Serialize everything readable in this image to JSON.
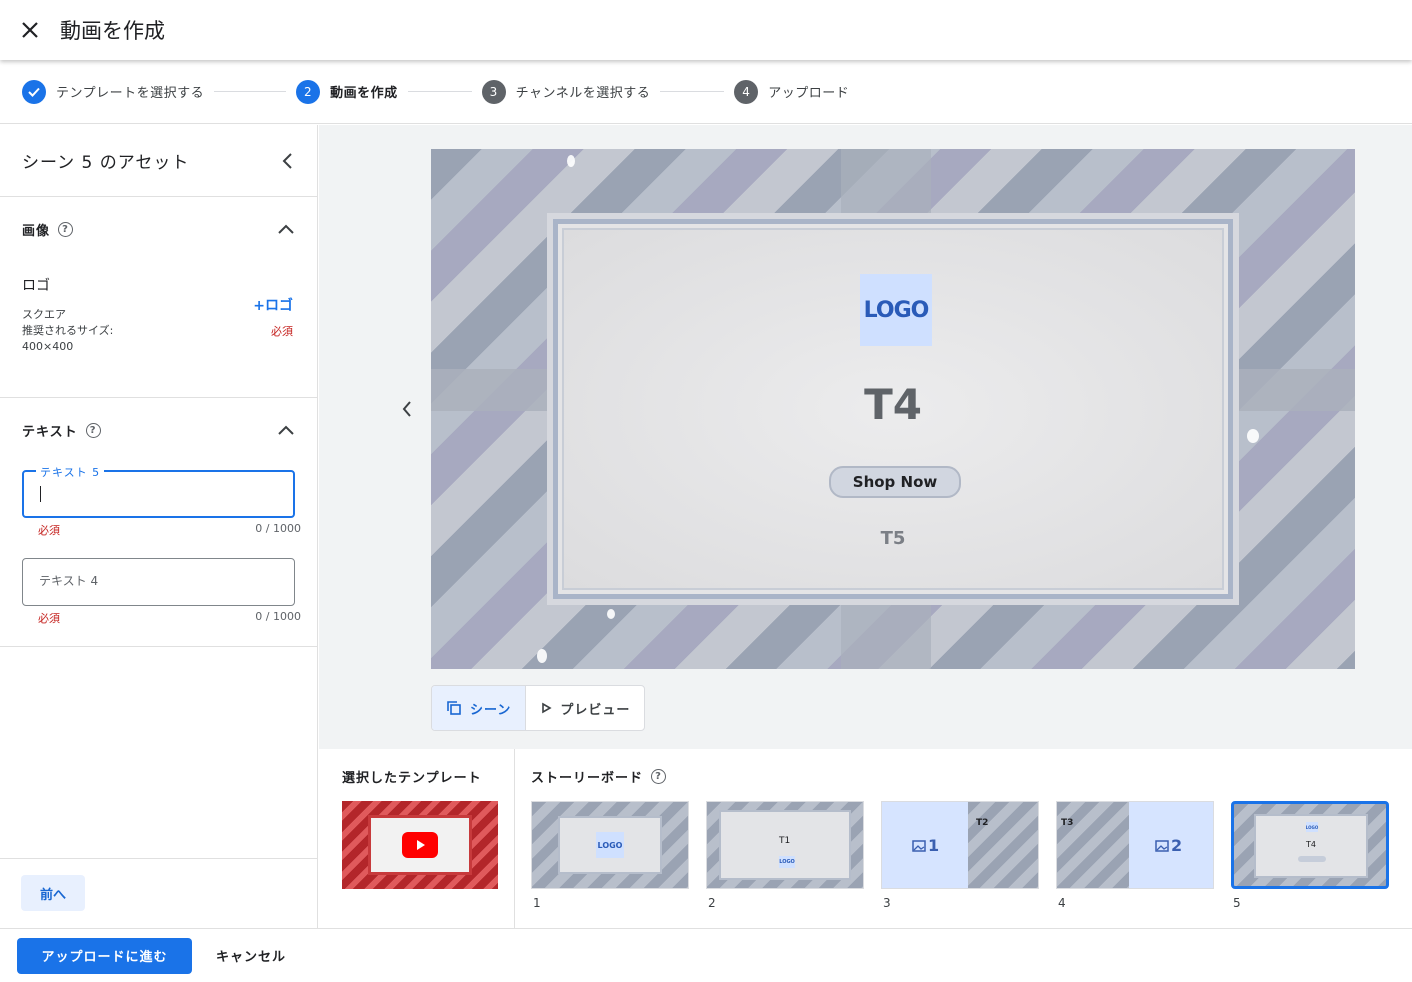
{
  "header": {
    "title": "動画を作成"
  },
  "stepper": {
    "steps": [
      {
        "num": "",
        "label": "テンプレートを選択する"
      },
      {
        "num": "2",
        "label": "動画を作成"
      },
      {
        "num": "3",
        "label": "チャンネルを選択する"
      },
      {
        "num": "4",
        "label": "アップロード"
      }
    ]
  },
  "left_panel": {
    "title": "シーン 5 のアセット",
    "image_section": {
      "title": "画像",
      "help": "?",
      "logo_name": "ロゴ",
      "shape": "スクエア",
      "size_label": "推奨されるサイズ:",
      "size_value": "400×400",
      "add_label": "+ロゴ",
      "required": "必須"
    },
    "text_section": {
      "title": "テキスト",
      "help": "?",
      "field1": {
        "label": "テキスト 5",
        "value": "",
        "required": "必須",
        "count": "0 / 1000"
      },
      "field2": {
        "placeholder": "テキスト 4",
        "value": "",
        "required": "必須",
        "count": "0 / 1000"
      }
    },
    "back_label": "前へ"
  },
  "preview": {
    "logo_text": "LOGO",
    "headline": "T4",
    "cta": "Shop Now",
    "subtext": "T5",
    "toggle": {
      "scene_label": "シーン",
      "preview_label": "プレビュー"
    }
  },
  "bottom": {
    "selected_template_label": "選択したテンプレート",
    "storyboard_label": "ストーリーボード",
    "help": "?",
    "scenes": [
      {
        "num": "1",
        "logo": "LOGO"
      },
      {
        "num": "2",
        "t": "T1",
        "logo": "LOGO"
      },
      {
        "num": "3",
        "img": "1",
        "t": "T2"
      },
      {
        "num": "4",
        "img": "2",
        "t": "T3"
      },
      {
        "num": "5",
        "logo": "LOGO",
        "t": "T4"
      }
    ]
  },
  "footer": {
    "primary_label": "アップロードに進む",
    "cancel_label": "キャンセル"
  },
  "colors": {
    "accent": "#1a73e8",
    "error": "#c5221f"
  }
}
